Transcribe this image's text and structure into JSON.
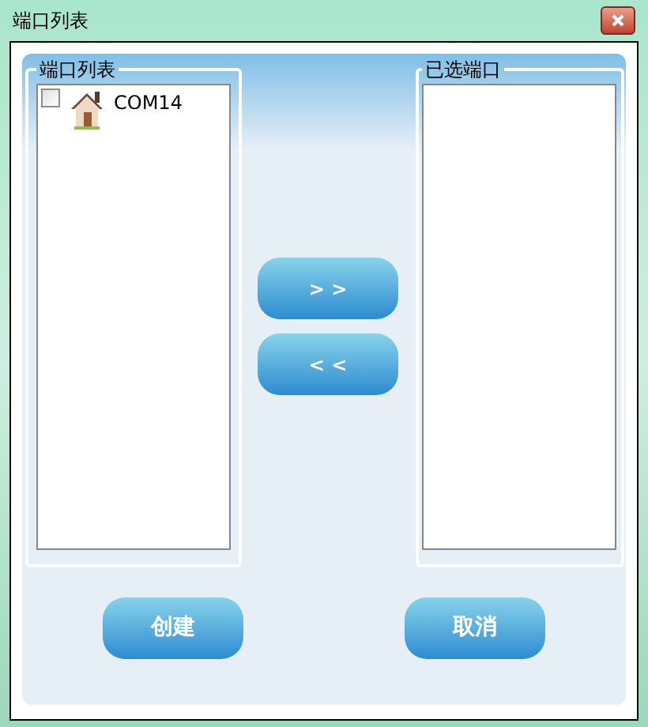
{
  "window": {
    "title": "端口列表"
  },
  "port_list": {
    "title": "端口列表",
    "items": [
      {
        "label": "COM14",
        "checked": false
      }
    ]
  },
  "transfer_buttons": [
    "> >",
    "< <"
  ],
  "selected_ports": {
    "title": "已选端口"
  },
  "actions": [
    "创建",
    "取消"
  ]
}
